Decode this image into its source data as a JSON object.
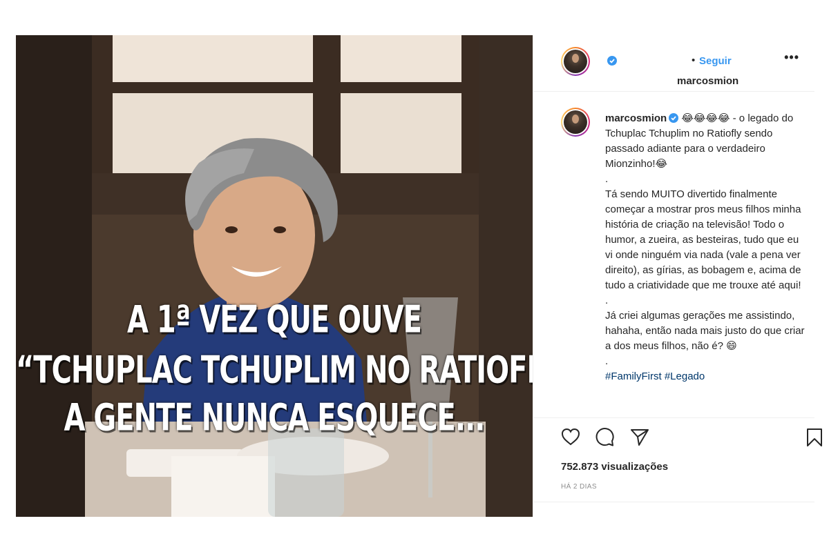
{
  "post": {
    "username": "marcosmion",
    "follow_label": "Seguir",
    "separator": "•",
    "more_label": "•••"
  },
  "video_overlay": {
    "line1": "A 1ª VEZ QUE OUVE",
    "line2": "“TCHUPLAC TCHUPLIM NO RATIOFLY”",
    "line3": "A GENTE NUNCA ESQUECE..."
  },
  "caption": {
    "username": "marcosmion",
    "text": " 😂😂😂😂 - o legado do Tchuplac Tchuplim no Ratiofly sendo passado adiante para o verdadeiro Mionzinho!😂\n.\nTá sendo MUITO divertido finalmente começar a mostrar pros meus filhos minha história de criação na televisão! Todo o humor, a zueira, as besteiras, tudo que eu vi onde ninguém via nada (vale a pena ver direito), as gírias, as bobagem e, acima de tudo a criatividade que me trouxe até aqui!\n.\nJá criei algumas gerações me assistindo, hahaha, então nada mais justo do que criar a dos meus filhos, não é? 😄\n.",
    "hashtags": "#FamilyFirst #Legado"
  },
  "stats": {
    "views": "752.873 visualizações",
    "date": "HÁ 2 DIAS"
  },
  "icons": {
    "like": "heart-icon",
    "comment": "comment-icon",
    "share": "paper-plane-icon",
    "save": "bookmark-icon",
    "verified": "verified-badge-icon"
  },
  "colors": {
    "link": "#3897f0",
    "verified": "#3897f0",
    "text": "#262626",
    "muted": "#8e8e8e",
    "border": "#efefef"
  }
}
